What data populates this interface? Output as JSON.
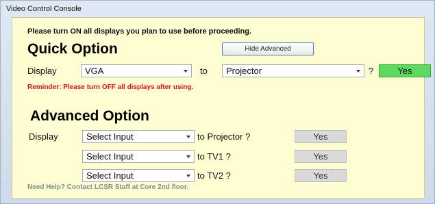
{
  "window": {
    "title": "Video Control Console"
  },
  "notice": "Please turn ON all displays you plan to use before proceeding.",
  "quick": {
    "heading": "Quick Option",
    "hide_advanced_label": "Hide Advanced",
    "display_label": "Display",
    "source_value": "VGA",
    "to_label": "to",
    "target_value": "Projector",
    "question": "?",
    "yes_label": "Yes",
    "reminder": "Reminder: Please turn OFF all displays after using."
  },
  "advanced": {
    "heading": "Advanced Option",
    "display_label": "Display",
    "rows": [
      {
        "input_value": "Select Input",
        "target_label": "to Projector ?",
        "yes_label": "Yes"
      },
      {
        "input_value": "Select Input",
        "target_label": "to TV1 ?",
        "yes_label": "Yes"
      },
      {
        "input_value": "Select Input",
        "target_label": "to TV2 ?",
        "yes_label": "Yes"
      }
    ]
  },
  "help": "Need Help? Contact LCSR Staff at Core 2nd floor.",
  "colors": {
    "panel_bg": "#fefed2",
    "window_bg": "#d6e0ec",
    "yes_active": "#5ed960",
    "yes_disabled": "#dadada",
    "reminder_text": "#e0102a",
    "help_text": "#7f8f8f"
  },
  "icons": {
    "dropdown": "chevron-down-icon"
  }
}
